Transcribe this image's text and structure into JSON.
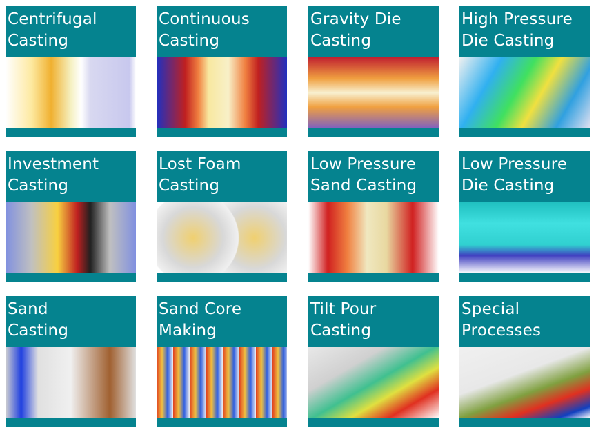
{
  "colors": {
    "teal": "#05838f"
  },
  "tiles": [
    {
      "title_line1": "Centrifugal",
      "title_line2": "Casting",
      "bg": "linear-gradient(90deg,#fff 0%,#fde9a0 20%,#f0b030 35%,#f5f0c0 50%,#fff 58%,#d8d8f0 65%,#c8c8ee 95%,#fff 100%)"
    },
    {
      "title_line1": "Continuous",
      "title_line2": "Casting",
      "bg": "linear-gradient(90deg,#2030c0 0%,#c02020 22%,#f08040 32%,#f8e8a0 40%,#f8f0c8 55%,#f08040 68%,#c02020 78%,#2030c0 100%)"
    },
    {
      "title_line1": "Gravity Die",
      "title_line2": "Casting",
      "bg": "linear-gradient(180deg,#c02030 0%,#f0a040 30%,#f8f0d0 50%,#f0a040 70%,#8060c0 100%)"
    },
    {
      "title_line1": "High Pressure",
      "title_line2": "Die Casting",
      "bg": "linear-gradient(120deg,#f0f0f0 0%,#30b0f0 25%,#40e060 45%,#f0e040 60%,#30a0e0 80%,#e0e0f0 100%)"
    },
    {
      "title_line1": "Investment",
      "title_line2": "Casting",
      "bg": "linear-gradient(90deg,#8090e0 0%,#c0c0c0 20%,#f8d040 40%,#c02020 55%,#202020 65%,#c0c0c0 80%,#8090e0 100%)"
    },
    {
      "title_line1": "Lost Foam",
      "title_line2": "Casting",
      "bg": "radial-gradient(circle at 28% 50%,#f0d070 0%,#d8d8d8 30%,#f0f0f0 45%,transparent 46%),radial-gradient(circle at 75% 50%,#f0d070 0%,#d8d8d8 30%,#f0f0f0 45%,#fff 47%)"
    },
    {
      "title_line1": "Low Pressure",
      "title_line2": "Sand Casting",
      "bg": "linear-gradient(90deg,#fff 0%,#d02020 15%,#f08040 30%,#f0e8c0 45%,#e8d8a0 60%,#d02020 80%,#fff 100%)"
    },
    {
      "title_line1": "Low Pressure",
      "title_line2": "Die Casting",
      "bg": "linear-gradient(180deg,#20c0c0 0%,#40e0e0 30%,#30d0d0 60%,#4040c0 75%,#fff 100%)"
    },
    {
      "title_line1": "Sand",
      "title_line2": "Casting",
      "bg": "linear-gradient(90deg,#d0d0d0 0%,#2040e0 12%,#e0e0e0 25%,#f0f0f0 50%,#a06030 80%,#e0e0e0 100%)"
    },
    {
      "title_line1": "Sand Core",
      "title_line2": "Making",
      "bg": "repeating-linear-gradient(90deg,#e04020 0px,#f0c040 8px,#3060e0 16px,#f0f0f0 24px)"
    },
    {
      "title_line1": "Tilt Pour",
      "title_line2": "Casting",
      "bg": "linear-gradient(150deg,#e8e8e8 0%,#d0d0d0 30%,#40c090 50%,#e0e040 65%,#e03020 80%,#fff 100%)"
    },
    {
      "title_line1": "Special",
      "title_line2": "Processes",
      "bg": "linear-gradient(160deg,#f0f0f0 0%,#e8e8e8 40%,#80a040 60%,#e03020 75%,#1040c0 90%,#fff 100%)"
    }
  ]
}
